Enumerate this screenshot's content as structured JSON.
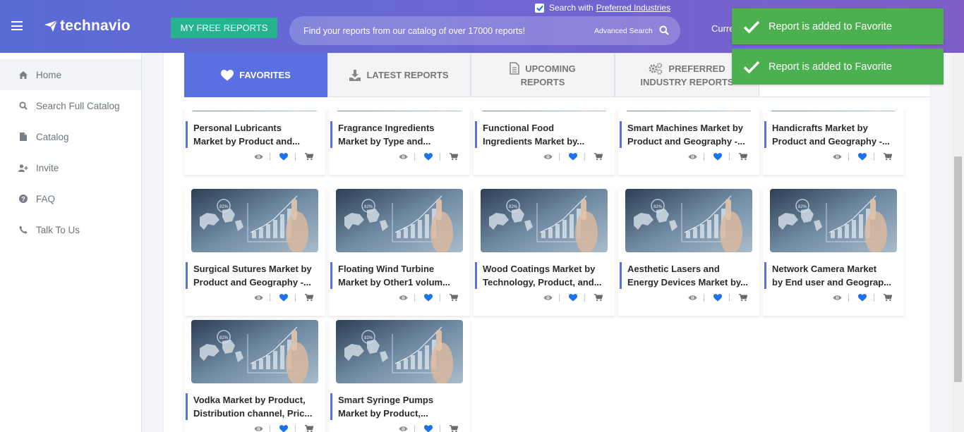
{
  "header": {
    "brand": "technavio",
    "free_reports_label": "MY FREE REPORTS",
    "search_placeholder": "Find your reports from our catalog of over 17000 reports!",
    "advanced_search_label": "Advanced Search",
    "preferred_checkbox_prefix": "Search with",
    "preferred_checkbox_link": "Preferred Industries",
    "preferred_checked": true,
    "currency_label": "Curre"
  },
  "sidebar": {
    "items": [
      {
        "label": "Home",
        "icon": "home-icon",
        "active": true
      },
      {
        "label": "Search Full Catalog",
        "icon": "search-icon",
        "active": false
      },
      {
        "label": "Catalog",
        "icon": "document-icon",
        "active": false
      },
      {
        "label": "Invite",
        "icon": "add-user-icon",
        "active": false
      },
      {
        "label": "FAQ",
        "icon": "question-circle-icon",
        "active": false
      },
      {
        "label": "Talk To Us",
        "icon": "phone-icon",
        "active": false
      }
    ]
  },
  "tabs": [
    {
      "line1": "FAVORITES",
      "line2": "",
      "icon": "heart-icon",
      "active": true
    },
    {
      "line1": "LATEST REPORTS",
      "line2": "",
      "icon": "download-icon",
      "active": false
    },
    {
      "line1": "UPCOMING",
      "line2": "REPORTS",
      "icon": "file-icon",
      "active": false
    },
    {
      "line1": "PREFERRED",
      "line2": "INDUSTRY REPORTS",
      "icon": "gears-icon",
      "active": false
    }
  ],
  "cards": [
    {
      "line1": "Personal Lubricants",
      "line2": "Market by Product and..."
    },
    {
      "line1": "Fragrance Ingredients",
      "line2": "Market by Type and..."
    },
    {
      "line1": "Functional Food",
      "line2": "Ingredients Market by..."
    },
    {
      "line1": "Smart Machines Market by",
      "line2": "Product and Geography -..."
    },
    {
      "line1": "Handicrafts Market by",
      "line2": "Product and Geography -..."
    },
    {
      "line1": "Surgical Sutures Market by",
      "line2": "Product and Geography -..."
    },
    {
      "line1": "Floating Wind Turbine",
      "line2": "Market by Other1 volum..."
    },
    {
      "line1": "Wood Coatings Market by",
      "line2": "Technology, Product, and..."
    },
    {
      "line1": "Aesthetic Lasers and",
      "line2": "Energy Devices Market by..."
    },
    {
      "line1": "Network Camera Market",
      "line2": "by End user and Geograp..."
    },
    {
      "line1": "Vodka Market by Product,",
      "line2": "Distribution channel, Pric..."
    },
    {
      "line1": "Smart Syringe Pumps",
      "line2": "Market by Product,..."
    }
  ],
  "thumbnail_badge": "82%",
  "toasts": [
    {
      "message": "Report is added to Favorite"
    },
    {
      "message": "Report is added to Favorite"
    }
  ],
  "colors": {
    "accent": "#5a6fe0",
    "free_button": "#26b38d",
    "toast": "#4caf50",
    "favorite_heart": "#1a73e8"
  }
}
